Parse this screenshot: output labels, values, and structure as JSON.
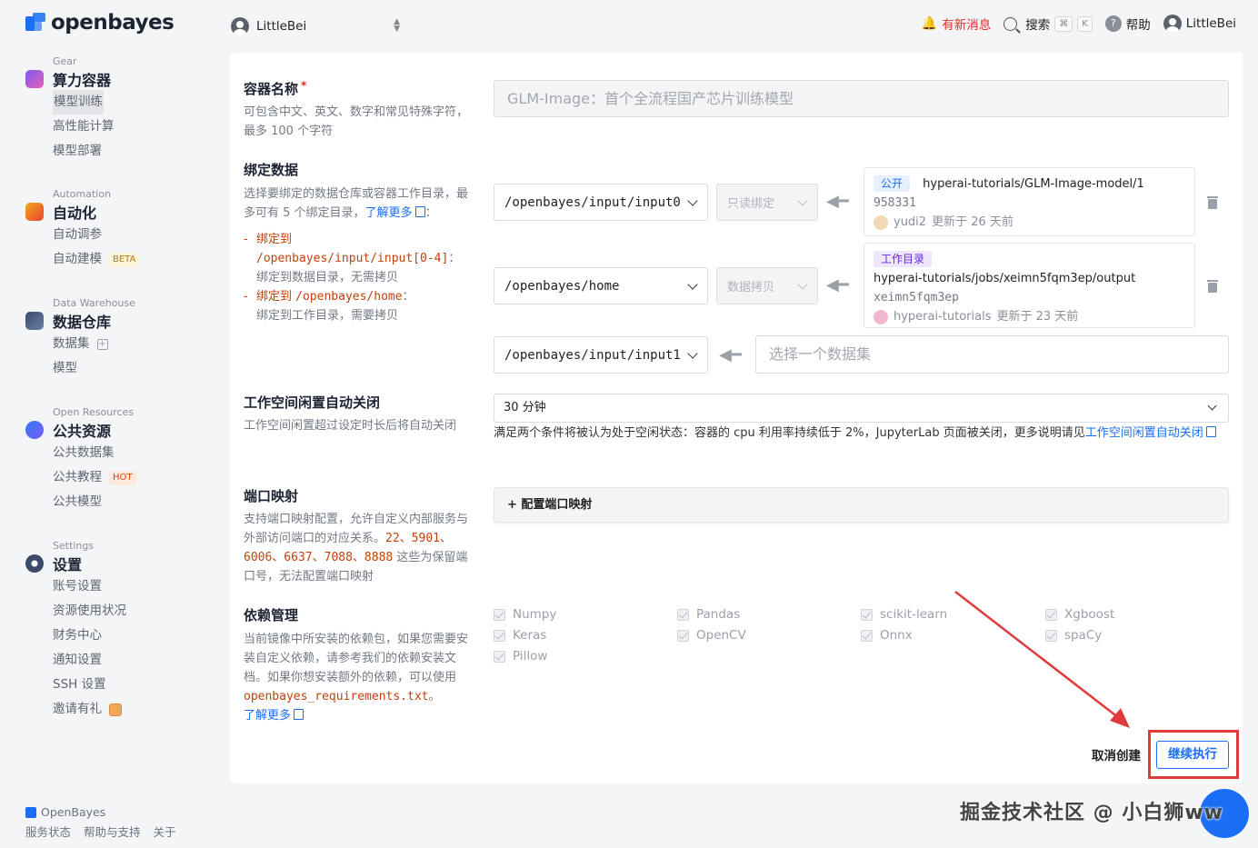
{
  "brand": {
    "name": "openbayes",
    "accent": "#1a6ef5"
  },
  "sidebar": {
    "groups": [
      {
        "caption": "Gear",
        "title": "算力容器",
        "items": [
          "模型训练",
          "高性能计算",
          "模型部署"
        ]
      },
      {
        "caption": "Automation",
        "title": "自动化",
        "items": [
          "自动调参",
          "自动建模"
        ],
        "badge": "BETA"
      },
      {
        "caption": "Data Warehouse",
        "title": "数据仓库",
        "items": [
          "数据集",
          "模型"
        ]
      },
      {
        "caption": "Open Resources",
        "title": "公共资源",
        "items": [
          "公共数据集",
          "公共教程",
          "公共模型"
        ],
        "badge": "HOT"
      },
      {
        "caption": "Settings",
        "title": "设置",
        "items": [
          "账号设置",
          "资源使用状况",
          "财务中心",
          "通知设置",
          "SSH 设置",
          "邀请有礼"
        ]
      }
    ]
  },
  "footer": {
    "brand": "OpenBayes",
    "links": [
      "服务状态",
      "帮助与支持",
      "关于"
    ]
  },
  "topbar": {
    "user_switch": "LittleBei",
    "notifications": "有新消息",
    "search": "搜索",
    "kbd_cmd": "⌘",
    "kbd_k": "K",
    "help": "帮助",
    "user": "LittleBei"
  },
  "form": {
    "name": {
      "title": "容器名称",
      "required": "*",
      "desc": "可包含中文、英文、数字和常见特殊字符，最多 100 个字符",
      "value": "GLM-Image：首个全流程国产芯片训练模型"
    },
    "bind": {
      "title": "绑定数据",
      "desc_a": "选择要绑定的数据仓库或容器工作目录，最多可有 5 个绑定目录，",
      "learn_more": "了解更多",
      "colon": "：",
      "rule1_label": "绑定到",
      "rule1_path": "/openbayes/input/input[0-4]",
      "rule1_desc": "绑定到数据目录，无需拷贝",
      "rule2_label": "绑定到",
      "rule2_path": "/openbayes/home",
      "rule2_desc": "绑定到工作目录，需要拷贝",
      "rows": [
        {
          "path": "/openbayes/input/input0",
          "mode": "只读绑定",
          "tag": "公开",
          "source": "hyperai-tutorials/GLM-Image-model/1",
          "id": "958331",
          "owner": "yudi2",
          "updated": "更新于 26 天前"
        },
        {
          "path": "/openbayes/home",
          "mode": "数据拷贝",
          "tag": "工作目录",
          "source": "hyperai-tutorials/jobs/xeimn5fqm3ep/output",
          "id": "xeimn5fqm3ep",
          "owner": "hyperai-tutorials",
          "updated": "更新于 23 天前"
        },
        {
          "path": "/openbayes/input/input1",
          "placeholder": "选择一个数据集"
        }
      ]
    },
    "idle": {
      "title": "工作空间闲置自动关闭",
      "desc": "工作空间闲置超过设定时长后将自动关闭",
      "value": "30 分钟",
      "hint": "满足两个条件将被认为处于空闲状态：容器的 cpu 利用率持续低于 2%，JupyterLab 页面被关闭，更多说明请见",
      "hint_link": "工作空间闲置自动关闭"
    },
    "ports": {
      "title": "端口映射",
      "desc_a": "支持端口映射配置，允许自定义内部服务与外部访问端口的对应关系。",
      "reserved": "22、5901、6006、6637、7088、8888",
      "desc_b": " 这些为保留端口号，无法配置端口映射",
      "button": "+ 配置端口映射"
    },
    "deps": {
      "title": "依赖管理",
      "desc_a": "当前镜像中所安装的依赖包，如果您需要安装自定义依赖，请参考我们的依赖安装文档。如果你想安装额外的依赖，可以使用 ",
      "file": "openbayes_requirements.txt",
      "desc_b": "。",
      "learn_more": "了解更多",
      "packages": [
        "Numpy",
        "Pandas",
        "scikit-learn",
        "Xgboost",
        "Keras",
        "OpenCV",
        "Onnx",
        "spaCy",
        "Pillow"
      ]
    },
    "actions": {
      "cancel": "取消创建",
      "continue": "继续执行"
    }
  },
  "watermark": "掘金技术社区 @ 小白狮ww"
}
